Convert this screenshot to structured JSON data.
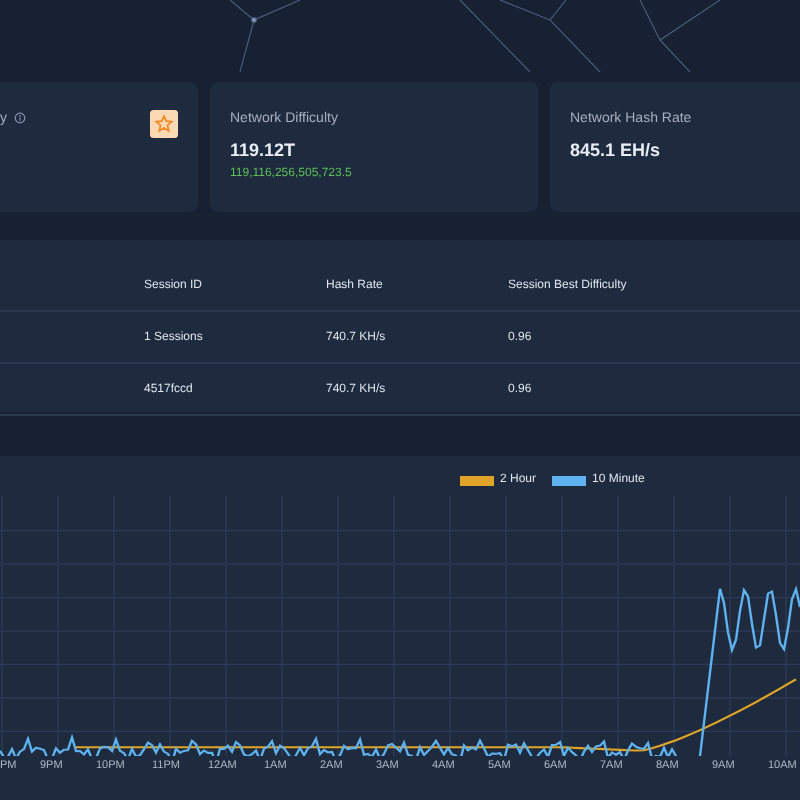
{
  "stat_cards": [
    {
      "title": "y",
      "info": true,
      "badge": true
    },
    {
      "title": "Network Difficulty",
      "value": "119.12T",
      "detail": "119,116,256,505,723.5"
    },
    {
      "title": "Network Hash Rate",
      "value": "845.1 EH/s"
    }
  ],
  "sessions_table": {
    "columns": [
      "Session ID",
      "Hash Rate",
      "Session Best Difficulty"
    ],
    "rows": [
      [
        "1 Sessions",
        "740.7 KH/s",
        "0.96"
      ],
      [
        "4517fccd",
        "740.7 KH/s",
        "0.96"
      ]
    ]
  },
  "hashrate_chart": {
    "legend": [
      {
        "label": "2 Hour",
        "color": "#e0a526"
      },
      {
        "label": "10 Minute",
        "color": "#5eb2f0"
      }
    ],
    "x_labels": [
      "PM",
      "9PM",
      "10PM",
      "11PM",
      "12AM",
      "1AM",
      "2AM",
      "3AM",
      "4AM",
      "5AM",
      "6AM",
      "7AM",
      "8AM",
      "9AM",
      "10AM"
    ]
  }
}
